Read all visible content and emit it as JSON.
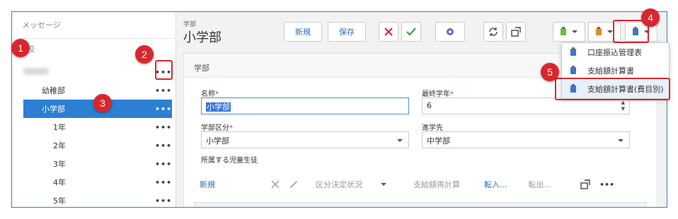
{
  "sidebar": {
    "message_label": "メッセージ",
    "school_label": "学校",
    "items": [
      {
        "label": "幼稚部",
        "more": "•••"
      },
      {
        "label": "小学部",
        "more": "•••"
      },
      {
        "label": "1年",
        "more": "•••"
      },
      {
        "label": "2年",
        "more": "•••"
      },
      {
        "label": "3年",
        "more": "•••"
      },
      {
        "label": "4年",
        "more": "•••"
      },
      {
        "label": "5年",
        "more": "•••"
      }
    ],
    "root_more": "•••"
  },
  "header": {
    "breadcrumb": "学部",
    "title": "小学部",
    "new_label": "新規",
    "save_label": "保存"
  },
  "panel": {
    "heading": "学部",
    "name_label": "名称",
    "name_value": "小学部",
    "final_grade_label": "最終学年",
    "final_grade_value": "6",
    "division_label": "学部区分",
    "division_value": "小学部",
    "next_label": "進学先",
    "next_value": "中学部",
    "students_label": "所属する児童生徒",
    "required_mark": "*"
  },
  "grid_toolbar": {
    "new_label": "新規",
    "decision_label": "区分決定状況",
    "recalc_label": "支給額再計算",
    "transfer_in_label": "転入...",
    "transfer_out_label": "転出...",
    "more": "•••"
  },
  "menu": {
    "items": [
      {
        "label": "口座振込管理表"
      },
      {
        "label": "支給額計算書"
      },
      {
        "label": "支給額計算書(費目別)"
      }
    ]
  },
  "callouts": [
    "1",
    "2",
    "3",
    "4",
    "5"
  ],
  "colors": {
    "accent": "#2d7fd3",
    "callout": "#d9262e",
    "green": "#6bbf3a",
    "orange": "#e08b2b",
    "blue": "#3a78c9"
  }
}
